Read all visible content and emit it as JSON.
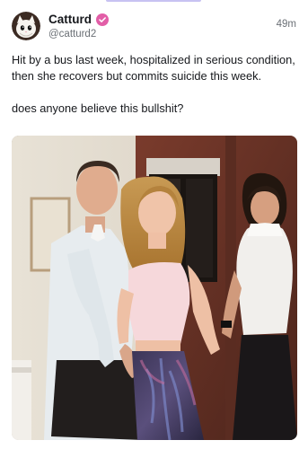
{
  "post": {
    "author": {
      "display_name": "Catturd",
      "handle": "@catturd2",
      "avatar_icon": "cat-avatar-icon",
      "verified_icon": "verified-badge-icon"
    },
    "timestamp": "49m",
    "body": [
      "Hit by a bus last week, hospitalized in serious condition, then she recovers but commits suicide this week.",
      "does anyone believe this bullshit?"
    ],
    "media": {
      "type": "photo"
    }
  },
  "colors": {
    "accent": "#c7c2f2",
    "verified_badge": "#e25ea7",
    "text": "#16181c",
    "muted_text": "#6b7076"
  }
}
